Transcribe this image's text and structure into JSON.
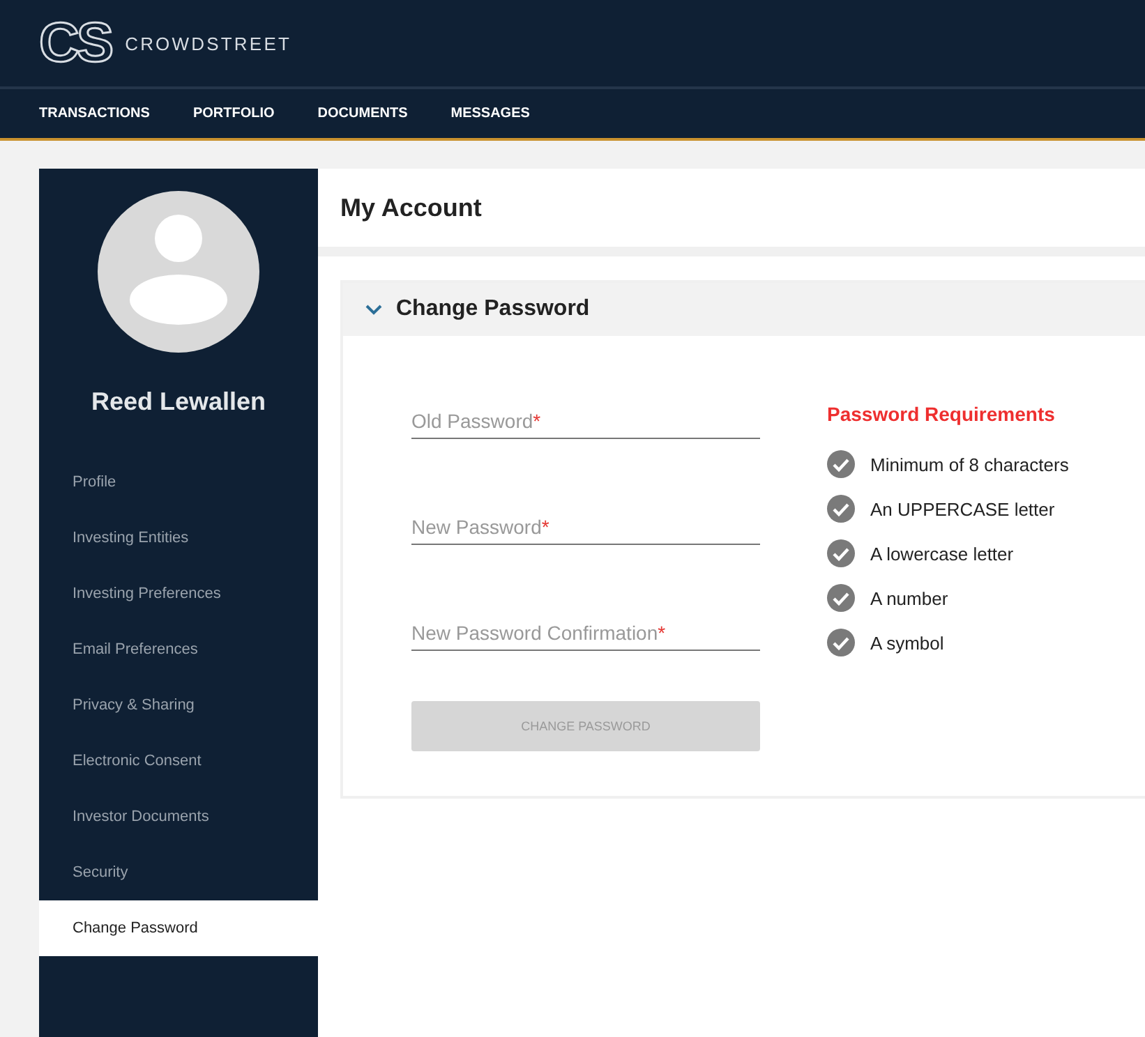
{
  "brand": {
    "mark": "CS",
    "name": "CROWDSTREET"
  },
  "nav": [
    {
      "label": "TRANSACTIONS",
      "selected": false
    },
    {
      "label": "PORTFOLIO",
      "selected": false
    },
    {
      "label": "DOCUMENTS",
      "selected": false
    },
    {
      "label": "MESSAGES",
      "selected": false
    }
  ],
  "sidebar": {
    "user_name": "Reed Lewallen",
    "items": [
      {
        "label": "Profile",
        "selected": false
      },
      {
        "label": "Investing Entities",
        "selected": false
      },
      {
        "label": "Investing Preferences",
        "selected": false
      },
      {
        "label": "Email Preferences",
        "selected": false
      },
      {
        "label": "Privacy & Sharing",
        "selected": false
      },
      {
        "label": "Electronic Consent",
        "selected": false
      },
      {
        "label": "Investor Documents",
        "selected": false
      },
      {
        "label": "Security",
        "selected": false
      },
      {
        "label": "Change Password",
        "selected": true
      }
    ]
  },
  "page_title": "My Account",
  "section": {
    "title": "Change Password",
    "expanded": true,
    "fields": [
      {
        "placeholder": "Old Password",
        "required_mark": "*"
      },
      {
        "placeholder": "New Password",
        "required_mark": "*"
      },
      {
        "placeholder": "New Password Confirmation",
        "required_mark": "*"
      }
    ],
    "submit": {
      "label": "CHANGE PASSWORD",
      "disabled": true
    },
    "requirements": {
      "title": "Password Requirements",
      "items": [
        {
          "label": "Minimum of 8 characters",
          "met": true
        },
        {
          "label": "An UPPERCASE letter",
          "met": true
        },
        {
          "label": "A lowercase letter",
          "met": true
        },
        {
          "label": "A number",
          "met": true
        },
        {
          "label": "A symbol",
          "met": true
        }
      ]
    }
  }
}
